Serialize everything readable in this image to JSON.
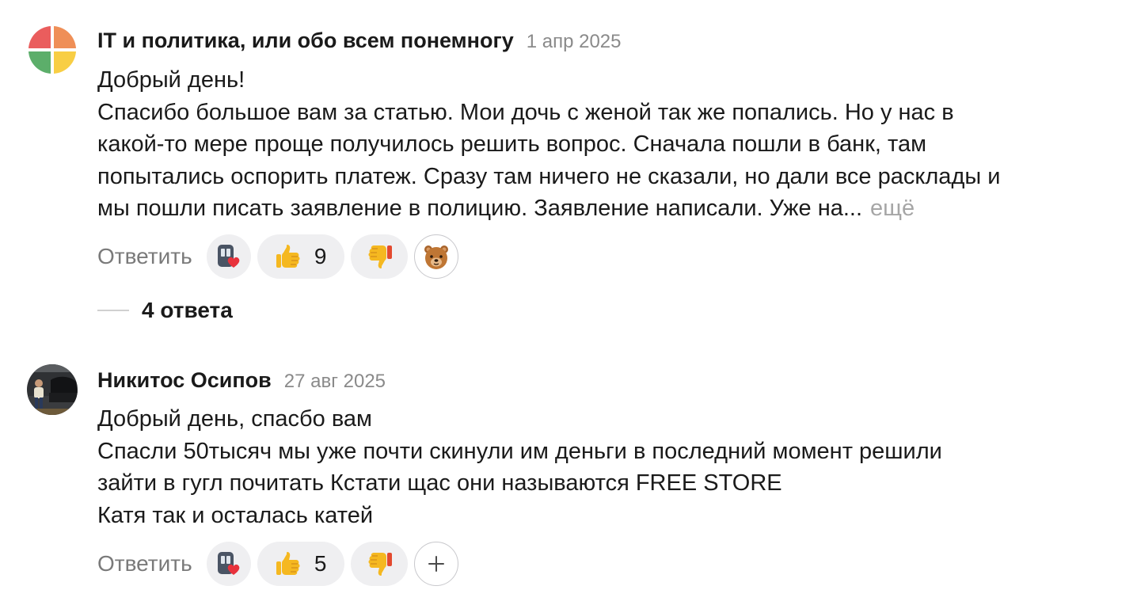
{
  "comments": [
    {
      "author": "IT и политика, или обо всем понемногу",
      "date": "1 апр 2025",
      "lines": [
        "Добрый день!",
        "Спасибо большое вам за статью. Мои дочь с женой так же попались. Но у нас в",
        "какой-то мере проще получилось решить вопрос. Сначала пошли в банк, там",
        "попытались оспорить платеж. Сразу там ничего не сказали, но дали все расклады и",
        "мы пошли писать заявление в полицию. Заявление написали. Уже на..."
      ],
      "more_label": "ещё",
      "reply_label": "Ответить",
      "likes": "9",
      "avatar_icon": "four-color-pinwheel",
      "reaction_icons": [
        "phone-heart-icon",
        "thumbs-up-icon",
        "thumbs-down-icon",
        "bear-face-icon"
      ],
      "replies_label": "4 ответа"
    },
    {
      "author": "Никитос Осипов",
      "date": "27 авг 2025",
      "lines": [
        "Добрый день, спасбо вам",
        "Спасли 50тысяч мы уже почти скинули им деньги в последний момент решили",
        "зайти в гугл почитать Кстати щас они называются FREE STORE",
        "Катя так и осталась катей"
      ],
      "reply_label": "Ответить",
      "likes": "5",
      "avatar_icon": "user-photo",
      "reaction_icons": [
        "phone-heart-icon",
        "thumbs-up-icon",
        "thumbs-down-icon",
        "add-reaction-icon"
      ]
    }
  ],
  "colors": {
    "text": "#1a1a1a",
    "muted": "#8a8a8a",
    "pill_bg": "#efeff1",
    "avatar_orange": "#ef8f57",
    "avatar_yellow": "#f8ce44",
    "avatar_green": "#5cae6a",
    "avatar_red": "#ea5d5d"
  }
}
